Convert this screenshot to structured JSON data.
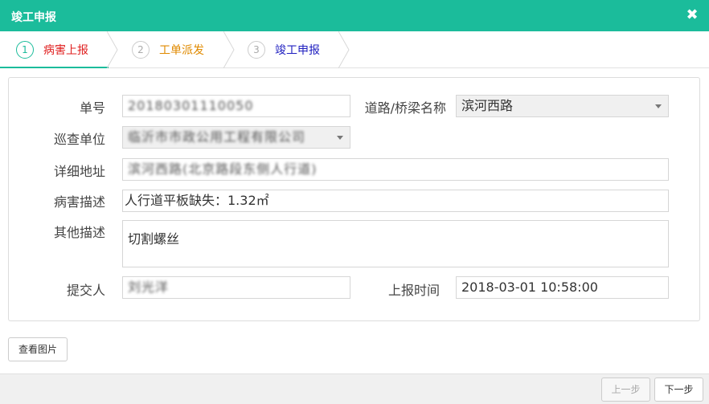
{
  "dialog": {
    "title": "竣工申报"
  },
  "steps": [
    {
      "number": "1",
      "label": "病害上报",
      "color": "#e02020"
    },
    {
      "number": "2",
      "label": "工单派发",
      "color": "#e08a00"
    },
    {
      "number": "3",
      "label": "竣工申报",
      "color": "#2020c0"
    }
  ],
  "form": {
    "order_no": {
      "label": "单号",
      "value": "20180301110050"
    },
    "road_bridge_name": {
      "label": "道路/桥梁名称",
      "value": "滨河西路"
    },
    "patrol_unit": {
      "label": "巡查单位",
      "value": "临沂市市政公用工程有限公司"
    },
    "detail_address": {
      "label": "详细地址",
      "value": "滨河西路(北京路段东侧人行道)"
    },
    "disease_desc": {
      "label": "病害描述",
      "value": "人行道平板缺失：1.32㎡"
    },
    "other_desc": {
      "label": "其他描述",
      "value": "切割螺丝"
    },
    "submitter": {
      "label": "提交人",
      "value": "刘光洋"
    },
    "report_time": {
      "label": "上报时间",
      "value": "2018-03-01 10:58:00"
    }
  },
  "buttons": {
    "view_images": "查看图片",
    "prev": "上一步",
    "next": "下一步"
  },
  "colors": {
    "accent": "#1bbc9b"
  }
}
